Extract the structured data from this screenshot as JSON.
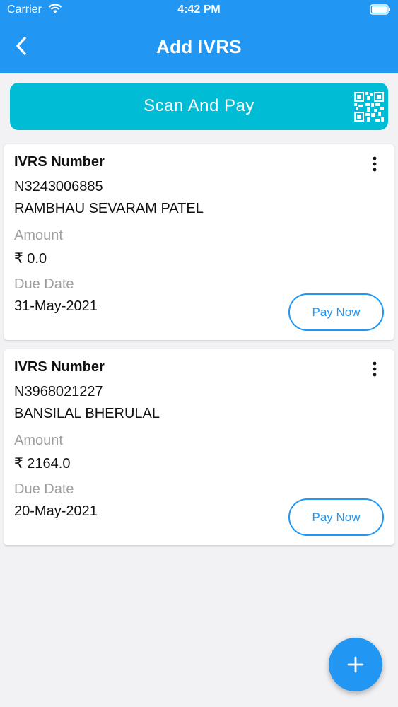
{
  "status_bar": {
    "carrier": "Carrier",
    "time": "4:42 PM"
  },
  "header": {
    "title": "Add IVRS",
    "back_icon": "chevron-left-icon"
  },
  "scan_button": {
    "label": "Scan And Pay",
    "icon": "qr-code-icon"
  },
  "cards": [
    {
      "ivrs_label": "IVRS Number",
      "ivrs_number": "N3243006885",
      "name": "RAMBHAU SEVARAM PATEL",
      "amount_label": "Amount",
      "amount": "₹ 0.0",
      "due_label": "Due Date",
      "due_date": "31-May-2021",
      "pay_label": "Pay Now"
    },
    {
      "ivrs_label": "IVRS Number",
      "ivrs_number": "N3968021227",
      "name": "BANSILAL BHERULAL",
      "amount_label": "Amount",
      "amount": "₹ 2164.0",
      "due_label": "Due Date",
      "due_date": "20-May-2021",
      "pay_label": "Pay Now"
    }
  ],
  "fab": {
    "icon": "plus-icon"
  },
  "colors": {
    "primary": "#2196f3",
    "scan": "#00bcd4",
    "muted": "#9e9e9e",
    "background": "#f2f2f4"
  }
}
